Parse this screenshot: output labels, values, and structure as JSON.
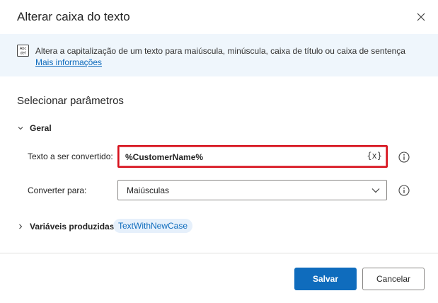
{
  "dialog": {
    "title": "Alterar caixa do texto",
    "close_icon": "close-icon"
  },
  "info": {
    "icon": "text-case-icon",
    "icon_glyph_top": "Abc",
    "icon_glyph_bottom": "def",
    "description": "Altera a capitalização de um texto para maiúscula, minúscula, caixa de título ou caixa de sentença",
    "link": "Mais informações"
  },
  "parameters": {
    "section_title": "Selecionar parâmetros",
    "group_label": "Geral",
    "text_field": {
      "label": "Texto a ser convertido:",
      "value": "%CustomerName%",
      "variable_button": "{x}"
    },
    "convert_field": {
      "label": "Converter para:",
      "selected": "Maiúsculas"
    }
  },
  "produced": {
    "label": "Variáveis produzidas",
    "variable": "TextWithNewCase"
  },
  "footer": {
    "save_label": "Salvar",
    "cancel_label": "Cancelar"
  },
  "colors": {
    "accent": "#0f6cbd",
    "banner_bg": "#eff6fc",
    "highlight_border": "#d6111c"
  }
}
